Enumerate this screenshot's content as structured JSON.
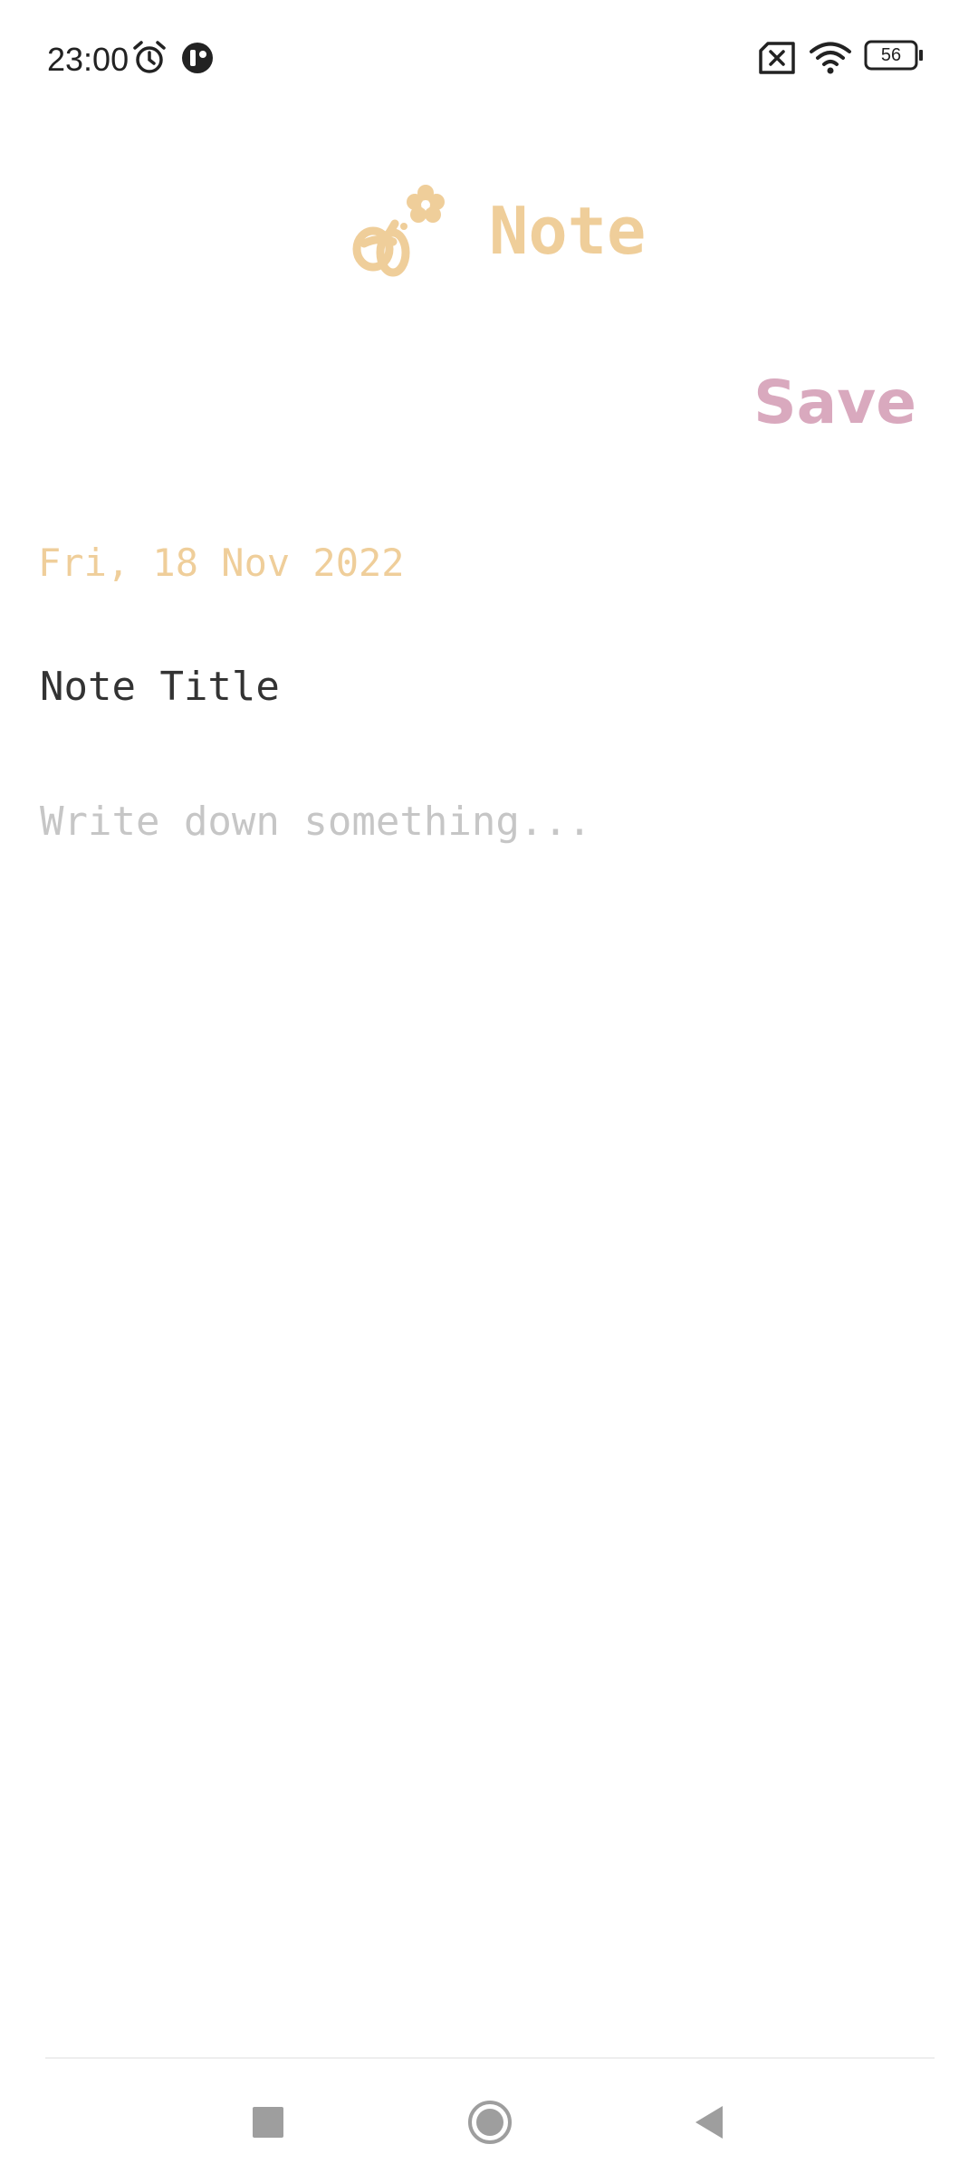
{
  "status_bar": {
    "time": "23:00",
    "battery_level": "56",
    "icons": [
      "alarm-icon",
      "app-notification-icon",
      "no-sim-icon",
      "wifi-icon",
      "battery-icon"
    ]
  },
  "header": {
    "title": "Note",
    "logo_icon": "bee-flower-icon",
    "accent_color": "#efce9a"
  },
  "toolbar": {
    "save_label": "Save",
    "save_color": "#d9a9be"
  },
  "note": {
    "date": "Fri, 18 Nov 2022",
    "title_placeholder": "Note Title",
    "body_placeholder": "Write down something..."
  },
  "nav_bar": {
    "icons": [
      "recents-icon",
      "home-icon",
      "back-icon"
    ]
  }
}
